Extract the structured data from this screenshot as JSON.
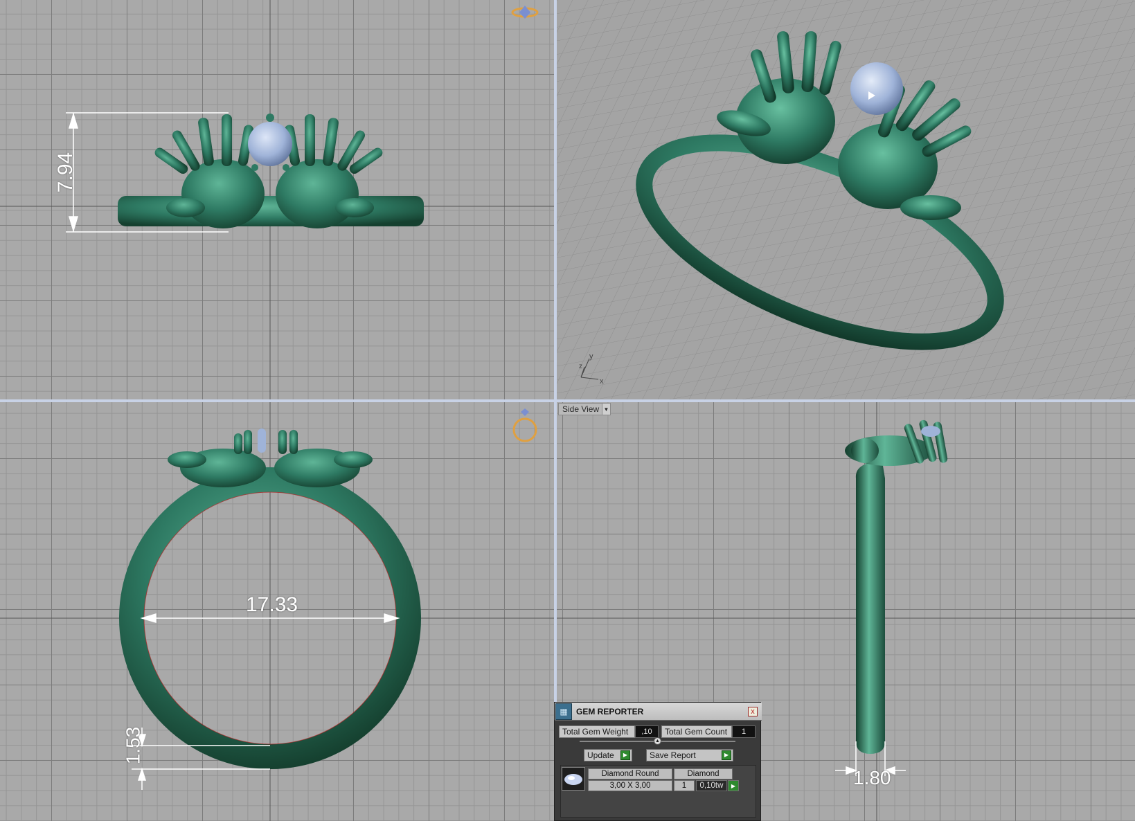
{
  "viewports": {
    "front": {
      "dimension_height": "7.94"
    },
    "top": {
      "dimension_inner_diameter": "17.33",
      "dimension_band_thickness": "1.53"
    },
    "side": {
      "view_selector": "Side View",
      "dimension_band_width": "1.80"
    },
    "perspective": {
      "axis_y": "y",
      "axis_x": "x",
      "axis_z": "z"
    }
  },
  "gem_reporter": {
    "title": "GEM REPORTER",
    "close_label": "x",
    "total_weight_label": "Total Gem Weight",
    "total_weight_value": ",10",
    "total_count_label": "Total Gem Count",
    "total_count_value": "1",
    "update_label": "Update",
    "save_report_label": "Save Report",
    "gems": [
      {
        "shape": "Diamond Round",
        "type": "Diamond",
        "size": "3,00 X 3,00",
        "count": "1",
        "weight": "0,10tw"
      }
    ]
  },
  "colors": {
    "metal": "#2e7a63",
    "gem": "#9fb3d8",
    "dimension": "#ffffff",
    "grid_major": "#7c7c7c",
    "grid_minor": "#959595"
  },
  "icons": [
    "ring-gem-orientation-icon",
    "ring-top-orientation-icon",
    "gem-reporter-icon",
    "close-icon",
    "go-arrow-icon",
    "diamond-thumbnail-icon"
  ]
}
